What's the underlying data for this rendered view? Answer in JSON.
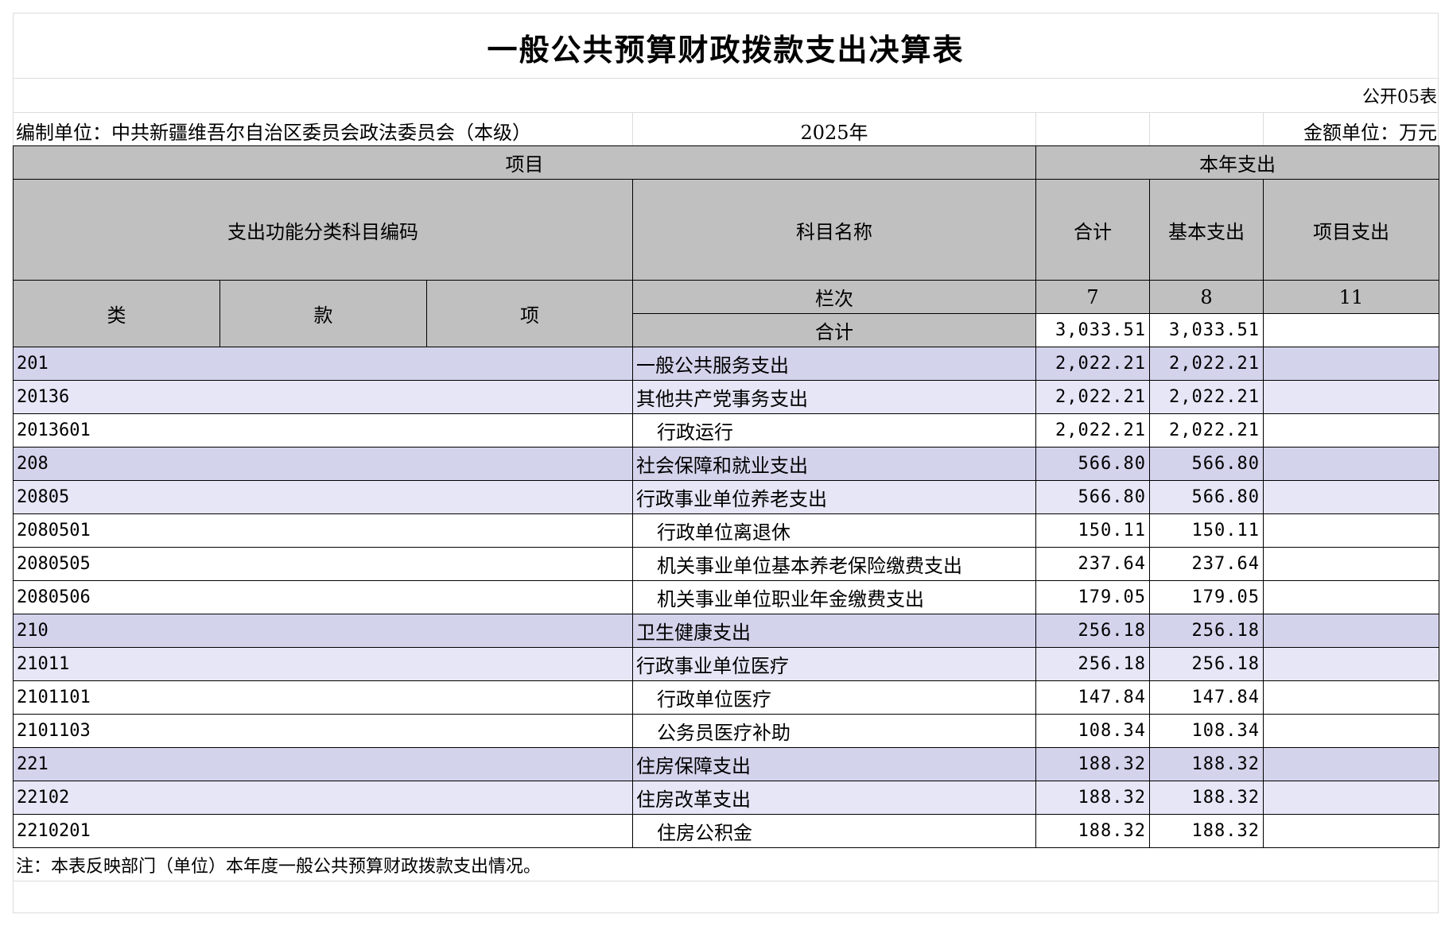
{
  "title": "一般公共预算财政拨款支出决算表",
  "table_code": "公开05表",
  "unit_label": "编制单位：中共新疆维吾尔自治区委员会政法委员会（本级）",
  "year": "2025年",
  "amount_unit": "金额单位：万元",
  "header": {
    "item": "项目",
    "current_year": "本年支出",
    "code_col": "支出功能分类科目编码",
    "name_col": "科目名称",
    "total": "合计",
    "basic": "基本支出",
    "project": "项目支出",
    "lei": "类",
    "kuan": "款",
    "xiang": "项",
    "lanci": "栏次",
    "col_total": "7",
    "col_basic": "8",
    "col_project": "11",
    "sum_label": "合计",
    "sum_total": "3,033.51",
    "sum_basic": "3,033.51",
    "sum_project": ""
  },
  "rows": [
    {
      "code": "201",
      "name": "一般公共服务支出",
      "total": "2,022.21",
      "basic": "2,022.21",
      "project": "",
      "level": 1
    },
    {
      "code": "20136",
      "name": "其他共产党事务支出",
      "total": "2,022.21",
      "basic": "2,022.21",
      "project": "",
      "level": 2
    },
    {
      "code": "2013601",
      "name": "行政运行",
      "total": "2,022.21",
      "basic": "2,022.21",
      "project": "",
      "level": 3
    },
    {
      "code": "208",
      "name": "社会保障和就业支出",
      "total": "566.80",
      "basic": "566.80",
      "project": "",
      "level": 1
    },
    {
      "code": "20805",
      "name": "行政事业单位养老支出",
      "total": "566.80",
      "basic": "566.80",
      "project": "",
      "level": 2
    },
    {
      "code": "2080501",
      "name": "行政单位离退休",
      "total": "150.11",
      "basic": "150.11",
      "project": "",
      "level": 3
    },
    {
      "code": "2080505",
      "name": "机关事业单位基本养老保险缴费支出",
      "total": "237.64",
      "basic": "237.64",
      "project": "",
      "level": 3
    },
    {
      "code": "2080506",
      "name": "机关事业单位职业年金缴费支出",
      "total": "179.05",
      "basic": "179.05",
      "project": "",
      "level": 3
    },
    {
      "code": "210",
      "name": "卫生健康支出",
      "total": "256.18",
      "basic": "256.18",
      "project": "",
      "level": 1
    },
    {
      "code": "21011",
      "name": "行政事业单位医疗",
      "total": "256.18",
      "basic": "256.18",
      "project": "",
      "level": 2
    },
    {
      "code": "2101101",
      "name": "行政单位医疗",
      "total": "147.84",
      "basic": "147.84",
      "project": "",
      "level": 3
    },
    {
      "code": "2101103",
      "name": "公务员医疗补助",
      "total": "108.34",
      "basic": "108.34",
      "project": "",
      "level": 3
    },
    {
      "code": "221",
      "name": "住房保障支出",
      "total": "188.32",
      "basic": "188.32",
      "project": "",
      "level": 1
    },
    {
      "code": "22102",
      "name": "住房改革支出",
      "total": "188.32",
      "basic": "188.32",
      "project": "",
      "level": 2
    },
    {
      "code": "2210201",
      "name": "住房公积金",
      "total": "188.32",
      "basic": "188.32",
      "project": "",
      "level": 3
    }
  ],
  "footnote": "注：本表反映部门（单位）本年度一般公共预算财政拨款支出情况。",
  "colors": {
    "header_bg": "#c0c0c0",
    "level1_bg": "#d3d3ec",
    "level2_bg": "#e6e6f7",
    "level3_bg": "#ffffff"
  }
}
